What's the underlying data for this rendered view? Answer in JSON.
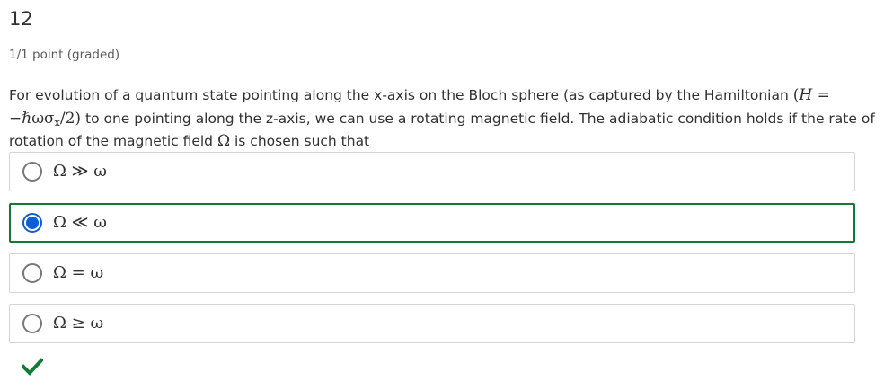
{
  "problem": {
    "number": "12",
    "points": "1/1 point (graded)",
    "question_part1": "For evolution of a quantum state pointing along the x-axis on the Bloch sphere (as captured by the Hamiltonian ",
    "hamiltonian_lhs": "H",
    "hamiltonian_eq": " = −ℏωσ",
    "hamiltonian_sub": "x",
    "hamiltonian_tail": "/2)",
    "question_part2": " to one pointing along the z-axis, we can use a rotating magnetic field. The adiabatic condition holds if the rate of rotation of the magnetic field ",
    "omega_symbol": "Ω",
    "question_part3": " is chosen such that"
  },
  "options": [
    {
      "label": "Ω ≫ ω",
      "selected": false
    },
    {
      "label": "Ω ≪ ω",
      "selected": true
    },
    {
      "label": "Ω = ω",
      "selected": false
    },
    {
      "label": "Ω ≥ ω",
      "selected": false
    }
  ],
  "result": {
    "icon": "checkmark-icon",
    "color": "#137a35"
  },
  "colors": {
    "selected_border": "#137a35",
    "radio_selected": "#0a5fd8"
  }
}
